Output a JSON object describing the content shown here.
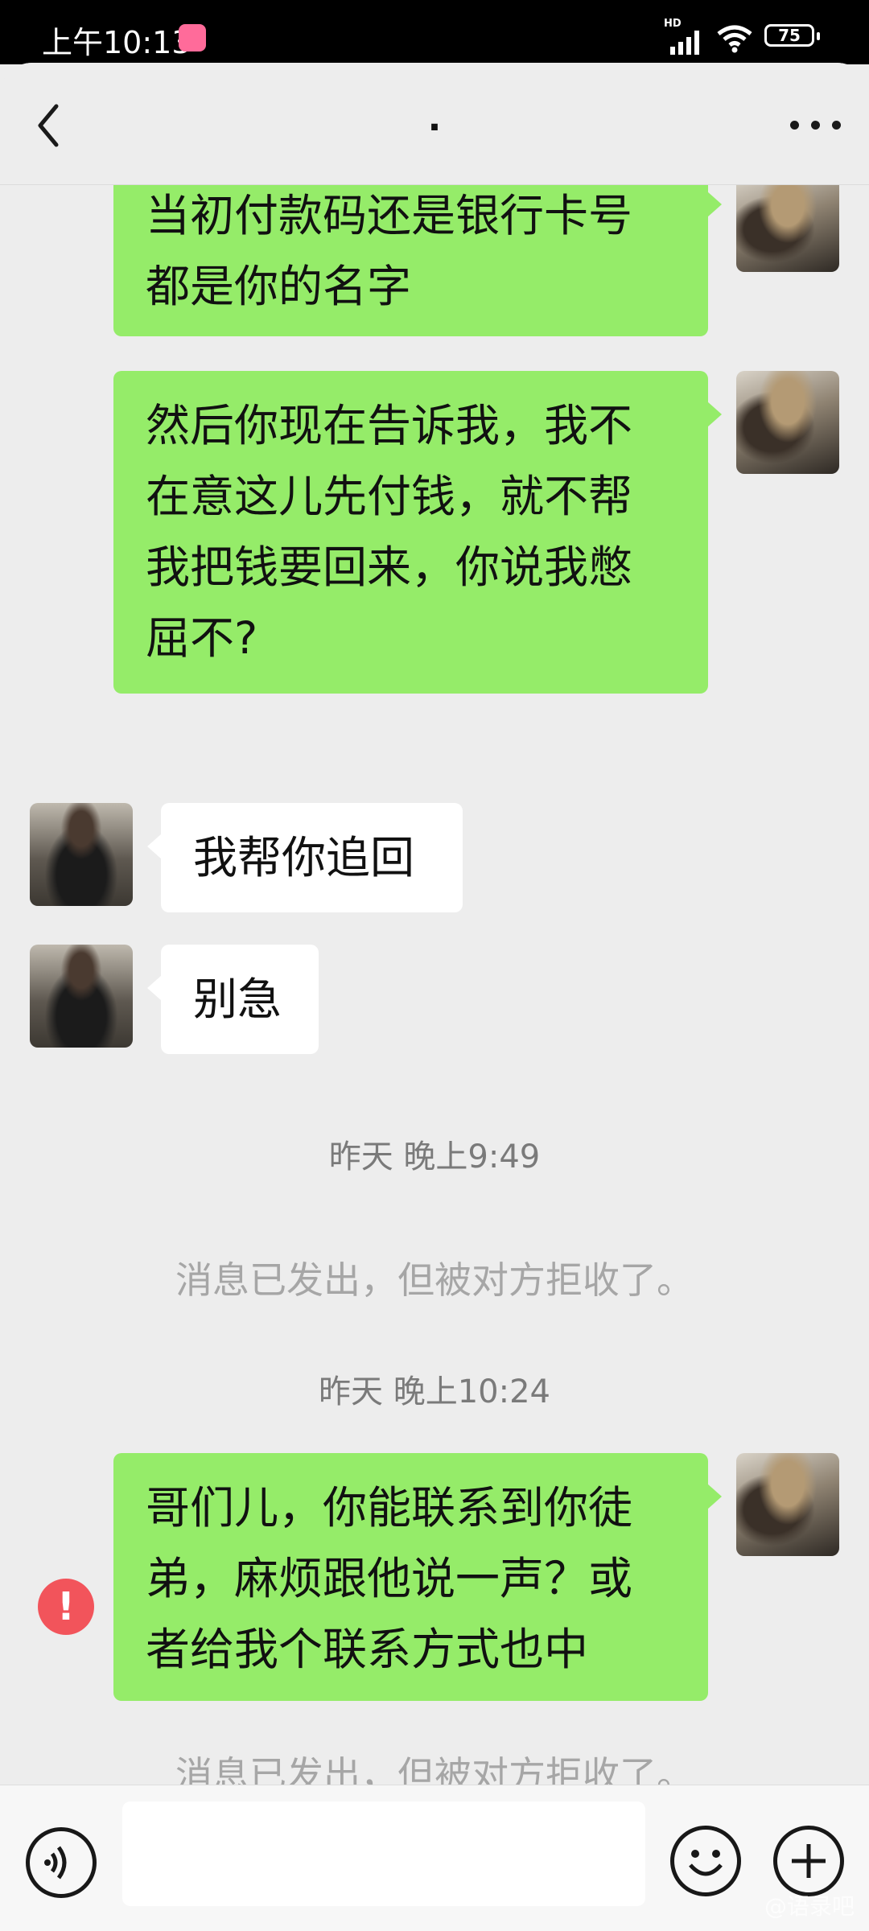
{
  "status_bar": {
    "time": "上午10:13",
    "network_label": "HD",
    "battery": "75"
  },
  "header": {
    "title": "."
  },
  "messages": [
    {
      "side": "out",
      "text": "当初付款码还是银行卡号\n都是你的名字"
    },
    {
      "side": "out",
      "text": "然后你现在告诉我，我不\n在意这儿先付钱，就不帮\n我把钱要回来，你说我憋\n屈不?"
    },
    {
      "side": "in",
      "text": "我帮你追回"
    },
    {
      "side": "in",
      "text": "别急"
    }
  ],
  "timestamps": [
    "昨天 晚上9:49",
    "昨天 晚上10:24"
  ],
  "system_notes": [
    "消息已发出，但被对方拒收了。",
    "消息已发出，但被对方拒收了。"
  ],
  "failed_message": {
    "side": "out",
    "text": "哥们儿，你能联系到你徒\n弟，麻烦跟他说一声？或\n者给我个联系方式也中",
    "error_icon": "!"
  },
  "input_bar": {
    "placeholder": "",
    "voice_icon": "voice-icon",
    "emoji_icon": "emoji-icon",
    "plus_icon": "plus-icon"
  },
  "watermark": "@语录吧",
  "colors": {
    "outgoing_bubble": "#95ec69",
    "incoming_bubble": "#ffffff",
    "background": "#ededed",
    "error": "#f2545b"
  }
}
